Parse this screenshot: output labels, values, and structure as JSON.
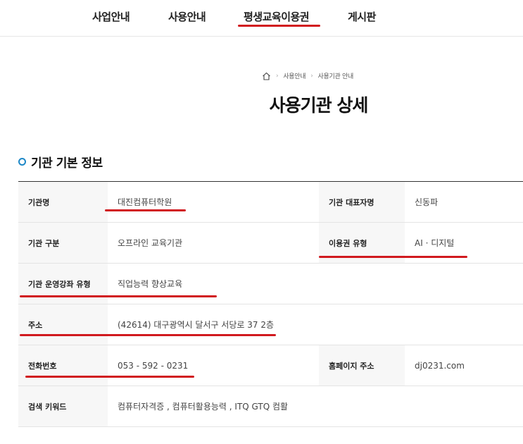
{
  "nav": {
    "items": [
      "사업안내",
      "사용안내",
      "평생교육이용권",
      "게시판"
    ]
  },
  "breadcrumb": {
    "items": [
      "사용안내",
      "사용기관 안내"
    ]
  },
  "page_title": "사용기관 상세",
  "section_title": "기관 기본 정보",
  "table": {
    "row1": {
      "label1": "기관명",
      "value1": "대진컴퓨터학원",
      "label2": "기관 대표자명",
      "value2": "신동파"
    },
    "row2": {
      "label1": "기관 구분",
      "value1": "오프라인 교육기관",
      "label2": "이용권 유형",
      "value2": "AI · 디지털"
    },
    "row3": {
      "label1": "기관 운영강좌 유형",
      "value1": "직업능력 향상교육"
    },
    "row4": {
      "label1": "주소",
      "value1": "(42614) 대구광역시 달서구 서당로 37 2층"
    },
    "row5": {
      "label1": "전화번호",
      "value1": "053 - 592 - 0231",
      "label2": "홈페이지 주소",
      "value2": "dj0231.com"
    },
    "row6": {
      "label1": "검색 키워드",
      "value1": "컴퓨터자격증 , 컴퓨터활용능력 , ITQ GTQ 컴활"
    }
  },
  "colors": {
    "underline": "#d11a1f",
    "section_icon": "#1e88c7"
  }
}
